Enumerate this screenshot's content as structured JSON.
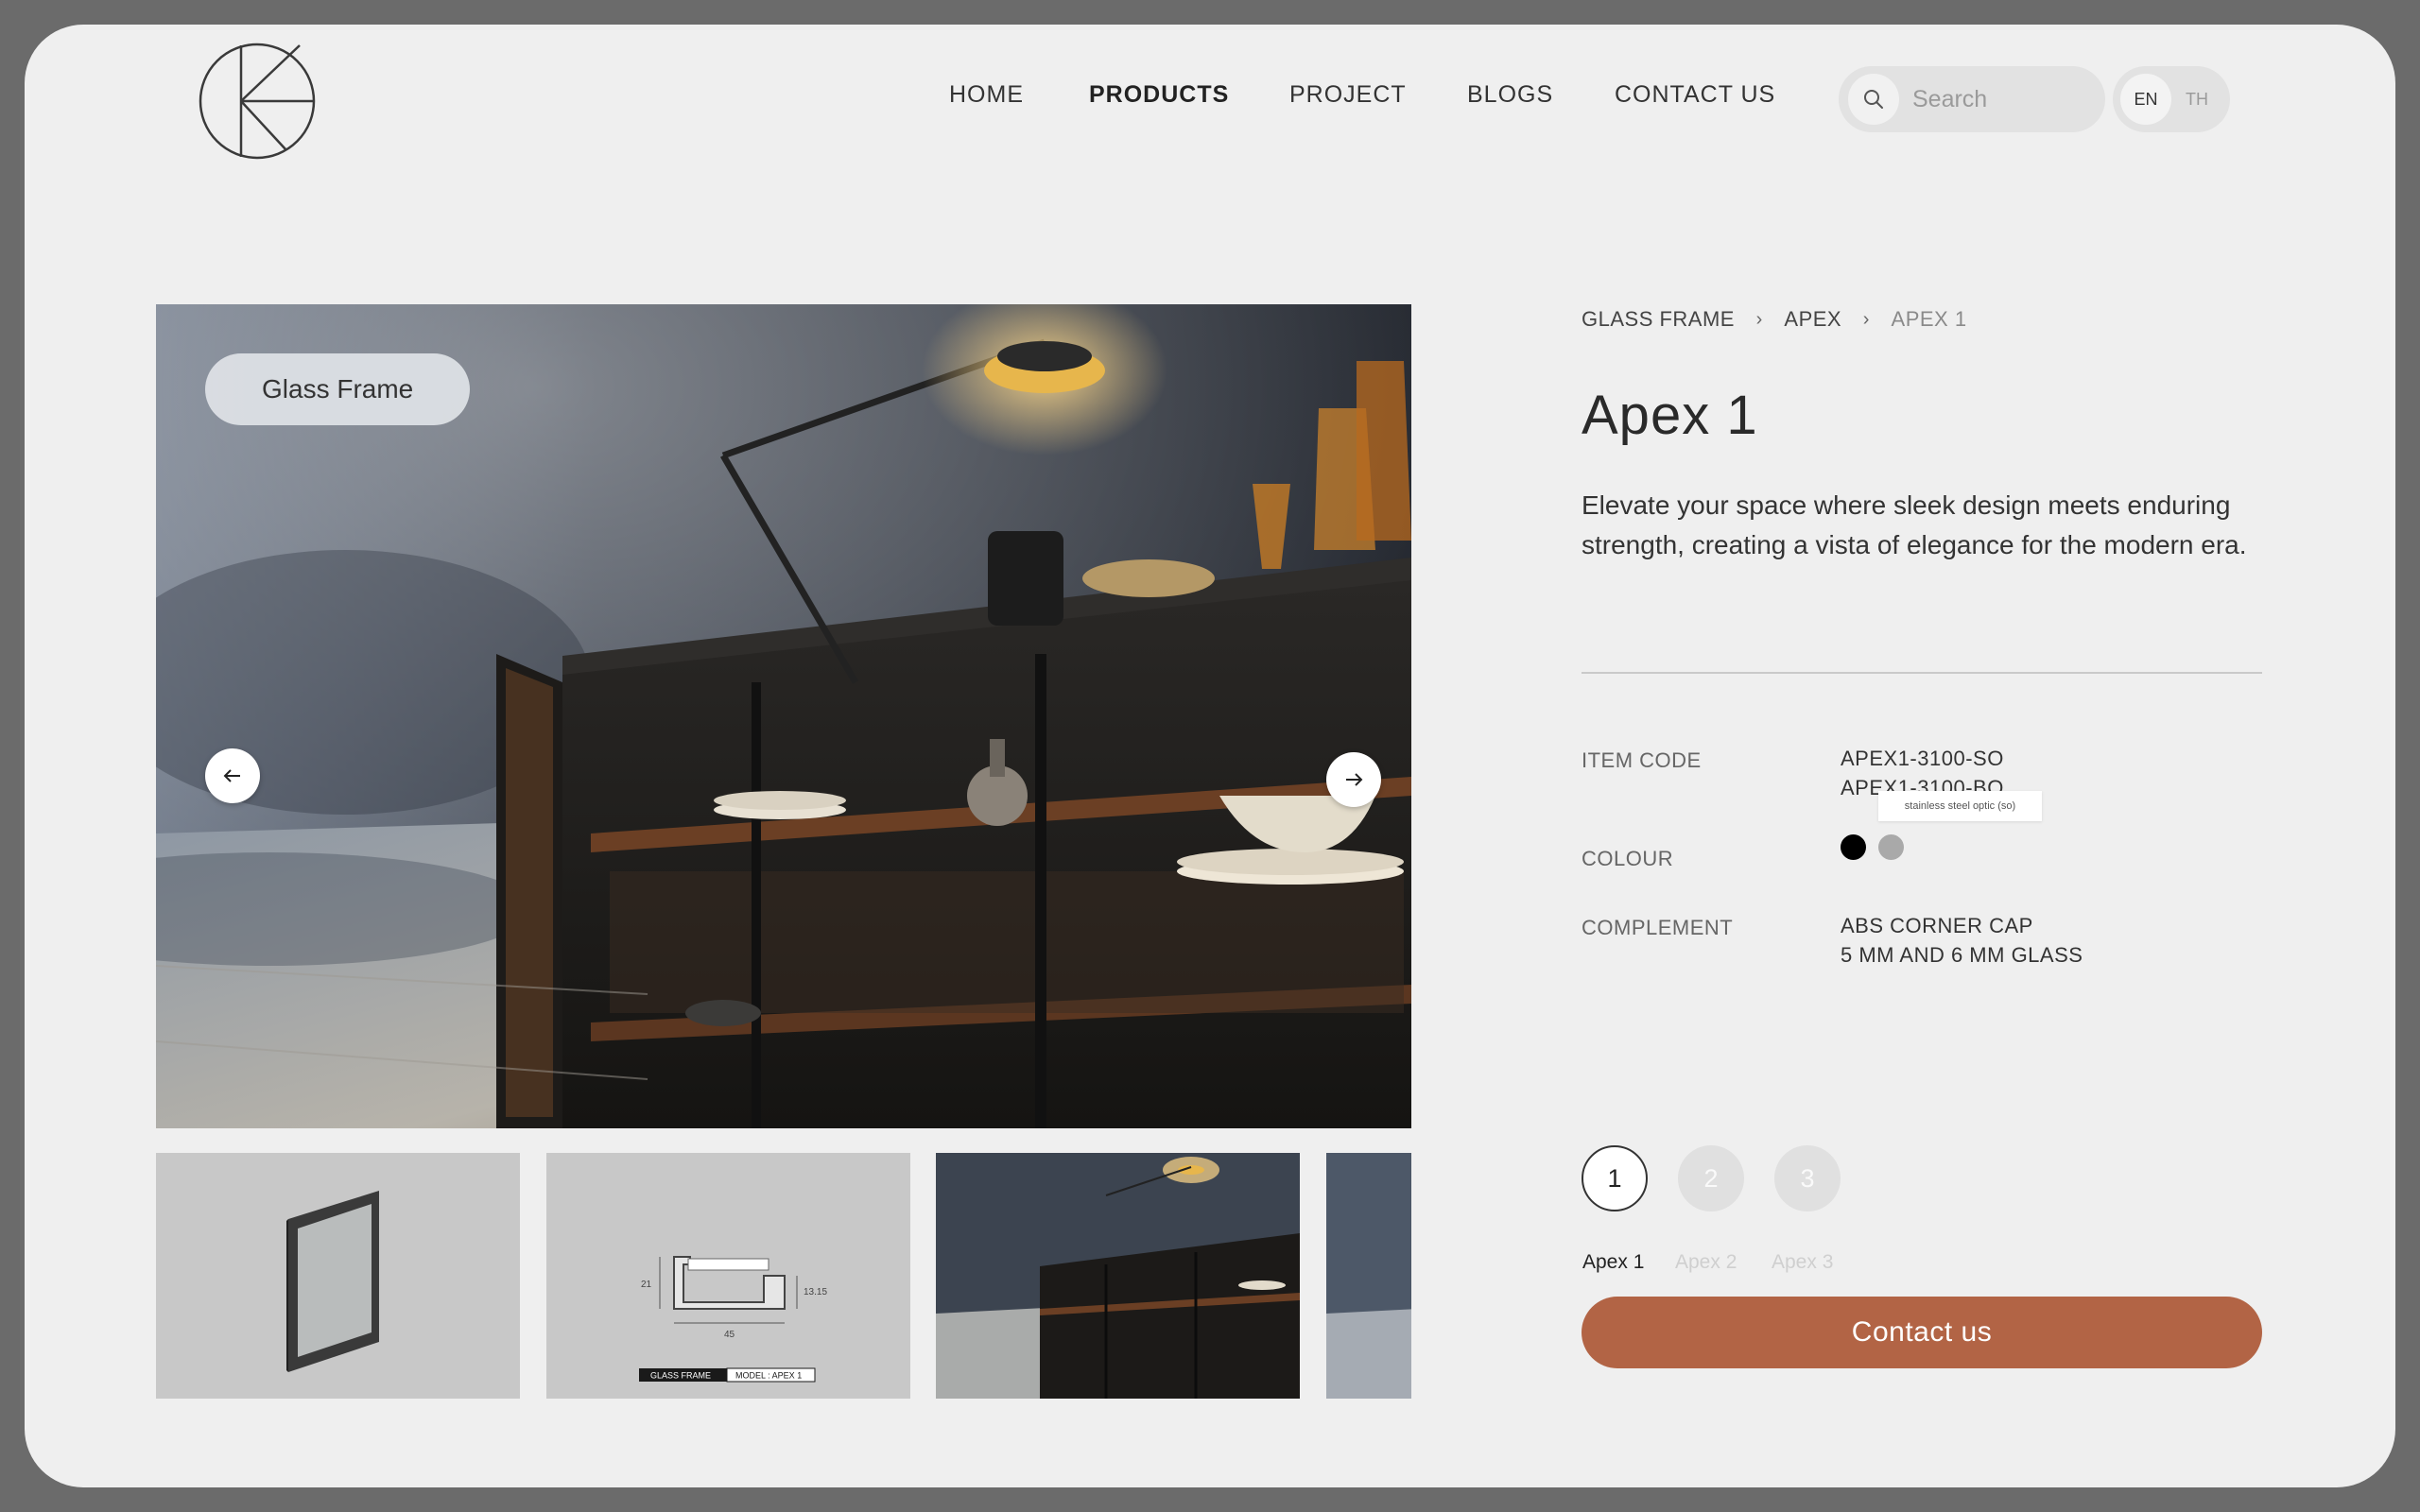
{
  "nav": {
    "items": [
      {
        "label": "HOME"
      },
      {
        "label": "PRODUCTS"
      },
      {
        "label": "PROJECT"
      },
      {
        "label": "BLOGS"
      },
      {
        "label": "CONTACT US"
      }
    ],
    "active": "PRODUCTS"
  },
  "search": {
    "placeholder": "Search",
    "icon": "search-icon"
  },
  "language": {
    "en": "EN",
    "th": "TH",
    "selected": "EN"
  },
  "hero": {
    "tag": "Glass Frame",
    "prev_icon": "arrow-left-icon",
    "next_icon": "arrow-right-icon"
  },
  "thumbnails": {
    "drawing_caption_left": "GLASS FRAME",
    "drawing_caption_right": "MODEL : APEX 1",
    "dim_width": "45",
    "dim_height": "21",
    "dim_right": "13.15"
  },
  "breadcrumb": {
    "items": [
      "GLASS FRAME",
      "APEX",
      "APEX 1"
    ],
    "separator_icon": "chevron-right-icon"
  },
  "product": {
    "title": "Apex 1",
    "description": "Elevate your space where sleek design meets enduring strength, creating a vista of elegance for the modern era.",
    "item_code_label": "ITEM CODE",
    "item_codes": [
      "APEX1-3100-SO",
      "APEX1-3100-BO"
    ],
    "colour_label": "COLOUR",
    "colours": [
      {
        "name": "black",
        "hex": "#000000"
      },
      {
        "name": "stainless steel optic (so)",
        "hex": "#a9a9a9"
      }
    ],
    "colour_tooltip": "stainless steel optic (so)",
    "complement_label": "COMPLEMENT",
    "complements": [
      "ABS CORNER CAP",
      "5 MM AND 6 MM GLASS"
    ]
  },
  "variants": [
    {
      "number": "1",
      "label": "Apex 1",
      "active": true
    },
    {
      "number": "2",
      "label": "Apex 2",
      "active": false
    },
    {
      "number": "3",
      "label": "Apex 3",
      "active": false
    }
  ],
  "cta": {
    "label": "Contact us"
  },
  "colors": {
    "accent": "#b26445",
    "background": "#efefef",
    "frame": "#6b6b6b"
  }
}
